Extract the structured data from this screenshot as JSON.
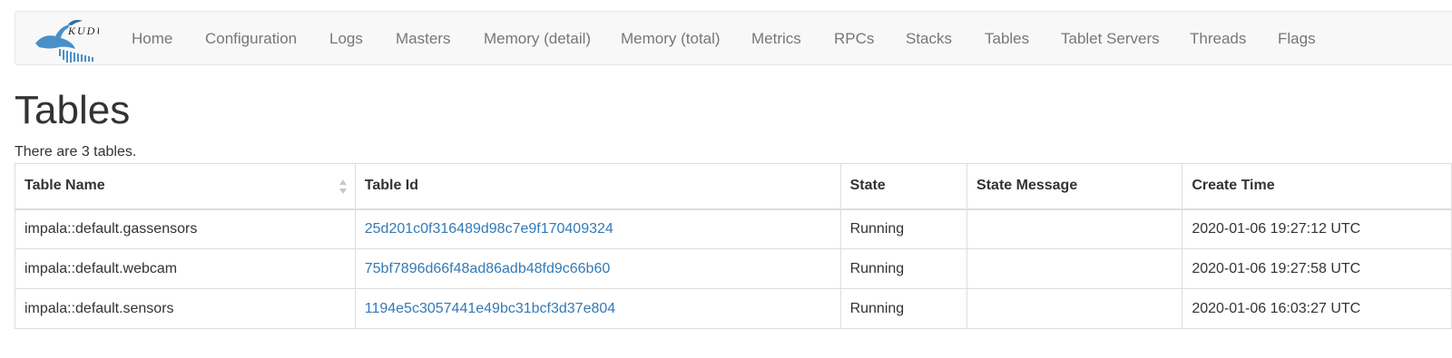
{
  "navbar": {
    "brand_text": "KUDU",
    "items": [
      {
        "label": "Home"
      },
      {
        "label": "Configuration"
      },
      {
        "label": "Logs"
      },
      {
        "label": "Masters"
      },
      {
        "label": "Memory (detail)"
      },
      {
        "label": "Memory (total)"
      },
      {
        "label": "Metrics"
      },
      {
        "label": "RPCs"
      },
      {
        "label": "Stacks"
      },
      {
        "label": "Tables"
      },
      {
        "label": "Tablet Servers"
      },
      {
        "label": "Threads"
      },
      {
        "label": "Flags"
      }
    ]
  },
  "page": {
    "title": "Tables",
    "summary": "There are 3 tables."
  },
  "table": {
    "columns": [
      "Table Name",
      "Table Id",
      "State",
      "State Message",
      "Create Time"
    ],
    "rows": [
      {
        "name": "impala::default.gassensors",
        "id": "25d201c0f316489d98c7e9f170409324",
        "state": "Running",
        "message": "",
        "created": "2020-01-06 19:27:12 UTC"
      },
      {
        "name": "impala::default.webcam",
        "id": "75bf7896d66f48ad86adb48fd9c66b60",
        "state": "Running",
        "message": "",
        "created": "2020-01-06 19:27:58 UTC"
      },
      {
        "name": "impala::default.sensors",
        "id": "1194e5c3057441e49bc31bcf3d37e804",
        "state": "Running",
        "message": "",
        "created": "2020-01-06 16:03:27 UTC"
      }
    ]
  },
  "colors": {
    "link": "#337ab7",
    "nav_text": "#777777",
    "navbar_bg": "#f8f8f8",
    "logo_blue": "#4a90c8"
  }
}
